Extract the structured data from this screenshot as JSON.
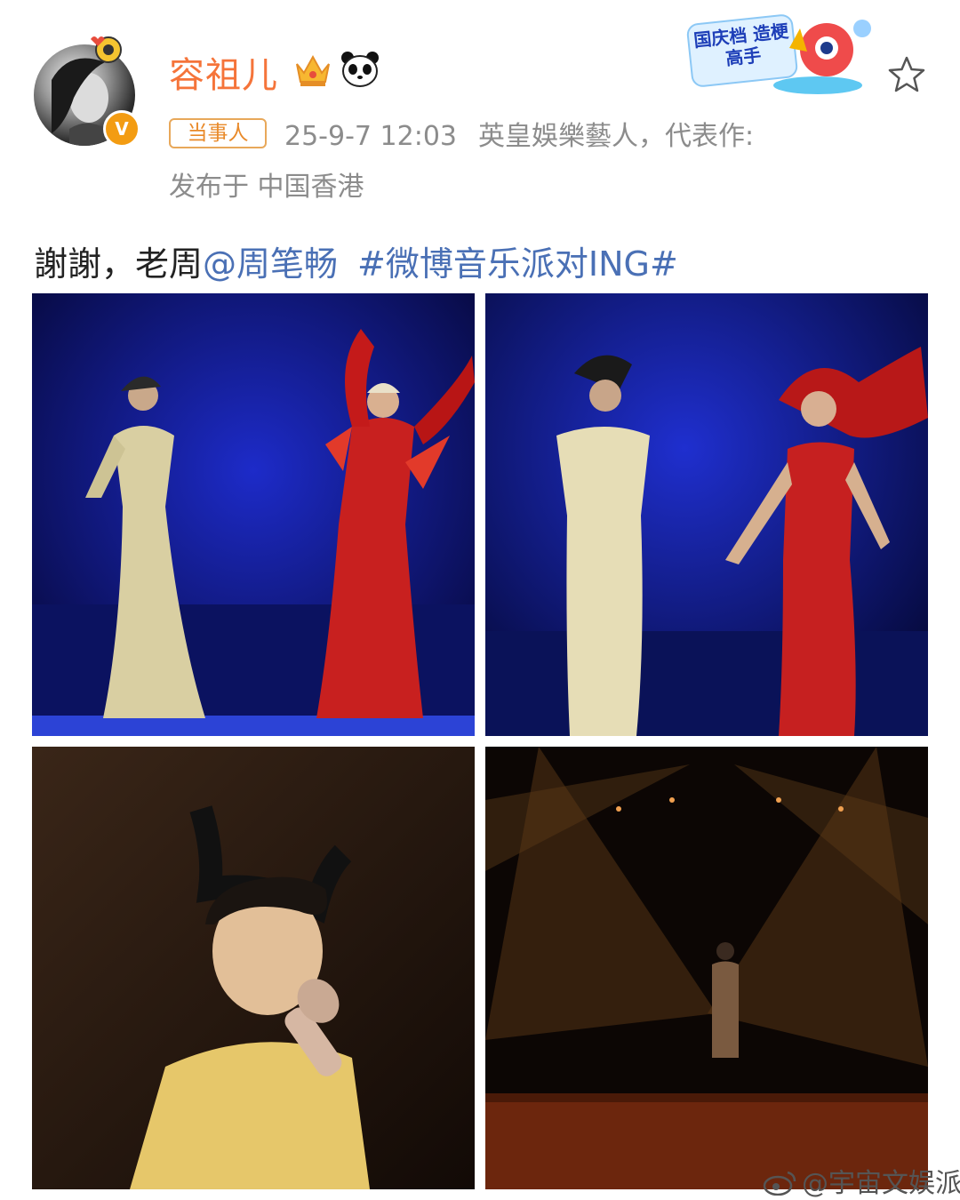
{
  "header": {
    "username": "容祖儿",
    "tag": "当事人",
    "timestamp": "25-9-7 12:03",
    "bio": "英皇娛樂藝人，代表作:",
    "location": "发布于 中国香港",
    "promo_sticker": "国庆档 造梗高手",
    "verified_mark": "V"
  },
  "post": {
    "text": "謝謝，老周",
    "mention": "@周笔畅",
    "hashtag": "#微博音乐派对ING#"
  },
  "watermark": "@宇宙文娱派",
  "icons": {
    "verified": "verified-badge-icon",
    "crown": "crown-icon",
    "panda": "panda-icon",
    "star": "star-icon",
    "weibo": "weibo-logo-icon"
  },
  "colors": {
    "username": "#f5743a",
    "link": "#4a70b5",
    "meta": "#8c8c8c",
    "tag_border": "#e8a85a"
  }
}
